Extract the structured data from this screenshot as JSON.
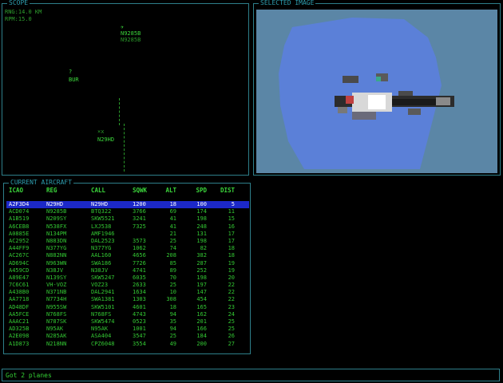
{
  "scope": {
    "title": "SCOPE",
    "range": "RNG:14.0 KM",
    "rpm": "RPM:15.0",
    "blips": [
      {
        "symbol": "✈",
        "id": "N9285B",
        "sub": "N9285B"
      },
      {
        "symbol": "?",
        "id": "BUR",
        "sub": ""
      },
      {
        "symbol": "×x",
        "id": "N29HD",
        "sub": ""
      }
    ]
  },
  "selected_image": {
    "title": "SELECTED IMAGE"
  },
  "aircraft": {
    "title": "CURRENT AIRCRAFT",
    "columns": [
      "ICAO",
      "REG",
      "CALL",
      "SQWK",
      "ALT",
      "SPD",
      "DIST"
    ],
    "rows": [
      [
        "A2F3D4",
        "N29HD",
        "N29HD",
        "1200",
        "18",
        "100",
        "5"
      ],
      [
        "ACD074",
        "N9285B",
        "BTQ322",
        "3766",
        "69",
        "174",
        "11"
      ],
      [
        "A1B519",
        "N209SY",
        "SKW5521",
        "3241",
        "41",
        "198",
        "15"
      ],
      [
        "A6CEB8",
        "N538FX",
        "LXJ538",
        "7325",
        "41",
        "248",
        "16"
      ],
      [
        "A0885E",
        "N134PM",
        "AMF1946",
        "",
        "21",
        "131",
        "17"
      ],
      [
        "AC2952",
        "N883DN",
        "DAL2523",
        "3573",
        "25",
        "198",
        "17"
      ],
      [
        "A44FF9",
        "N377YG",
        "N377YG",
        "1062",
        "74",
        "82",
        "18"
      ],
      [
        "AC267C",
        "N882NN",
        "AAL160",
        "4656",
        "208",
        "382",
        "18"
      ],
      [
        "AD694C",
        "N963WN",
        "SWA186",
        "7726",
        "85",
        "287",
        "19"
      ],
      [
        "A459CD",
        "N38JV",
        "N38JV",
        "4741",
        "89",
        "252",
        "19"
      ],
      [
        "A89E47",
        "N139SY",
        "SKW5247",
        "6035",
        "70",
        "198",
        "20"
      ],
      [
        "7C6C61",
        "VH-VOZ",
        "VOZ23",
        "2633",
        "25",
        "197",
        "22"
      ],
      [
        "A438B0",
        "N371NB",
        "DAL2941",
        "1634",
        "10",
        "147",
        "22"
      ],
      [
        "AA7718",
        "N7734H",
        "SWA1381",
        "1303",
        "308",
        "454",
        "22"
      ],
      [
        "AD48DF",
        "N955SW",
        "SKW5101",
        "4601",
        "18",
        "165",
        "23"
      ],
      [
        "AA5FCE",
        "N768FS",
        "N768FS",
        "4743",
        "94",
        "162",
        "24"
      ],
      [
        "AAAC21",
        "N787SK",
        "SKW5474",
        "0523",
        "35",
        "201",
        "25"
      ],
      [
        "AD325B",
        "N95AK",
        "N95AK",
        "1001",
        "94",
        "166",
        "25"
      ],
      [
        "A2E098",
        "N285AK",
        "ASA404",
        "3547",
        "25",
        "184",
        "26"
      ],
      [
        "A1D873",
        "N218NN",
        "CPZ6048",
        "3554",
        "49",
        "200",
        "27"
      ]
    ]
  },
  "status": {
    "message": "Got 2 planes"
  },
  "colors": {
    "border": "#2e7f8a",
    "text": "#34d034",
    "selection": "#1c28c8",
    "image_bg": "#5b86a6"
  }
}
